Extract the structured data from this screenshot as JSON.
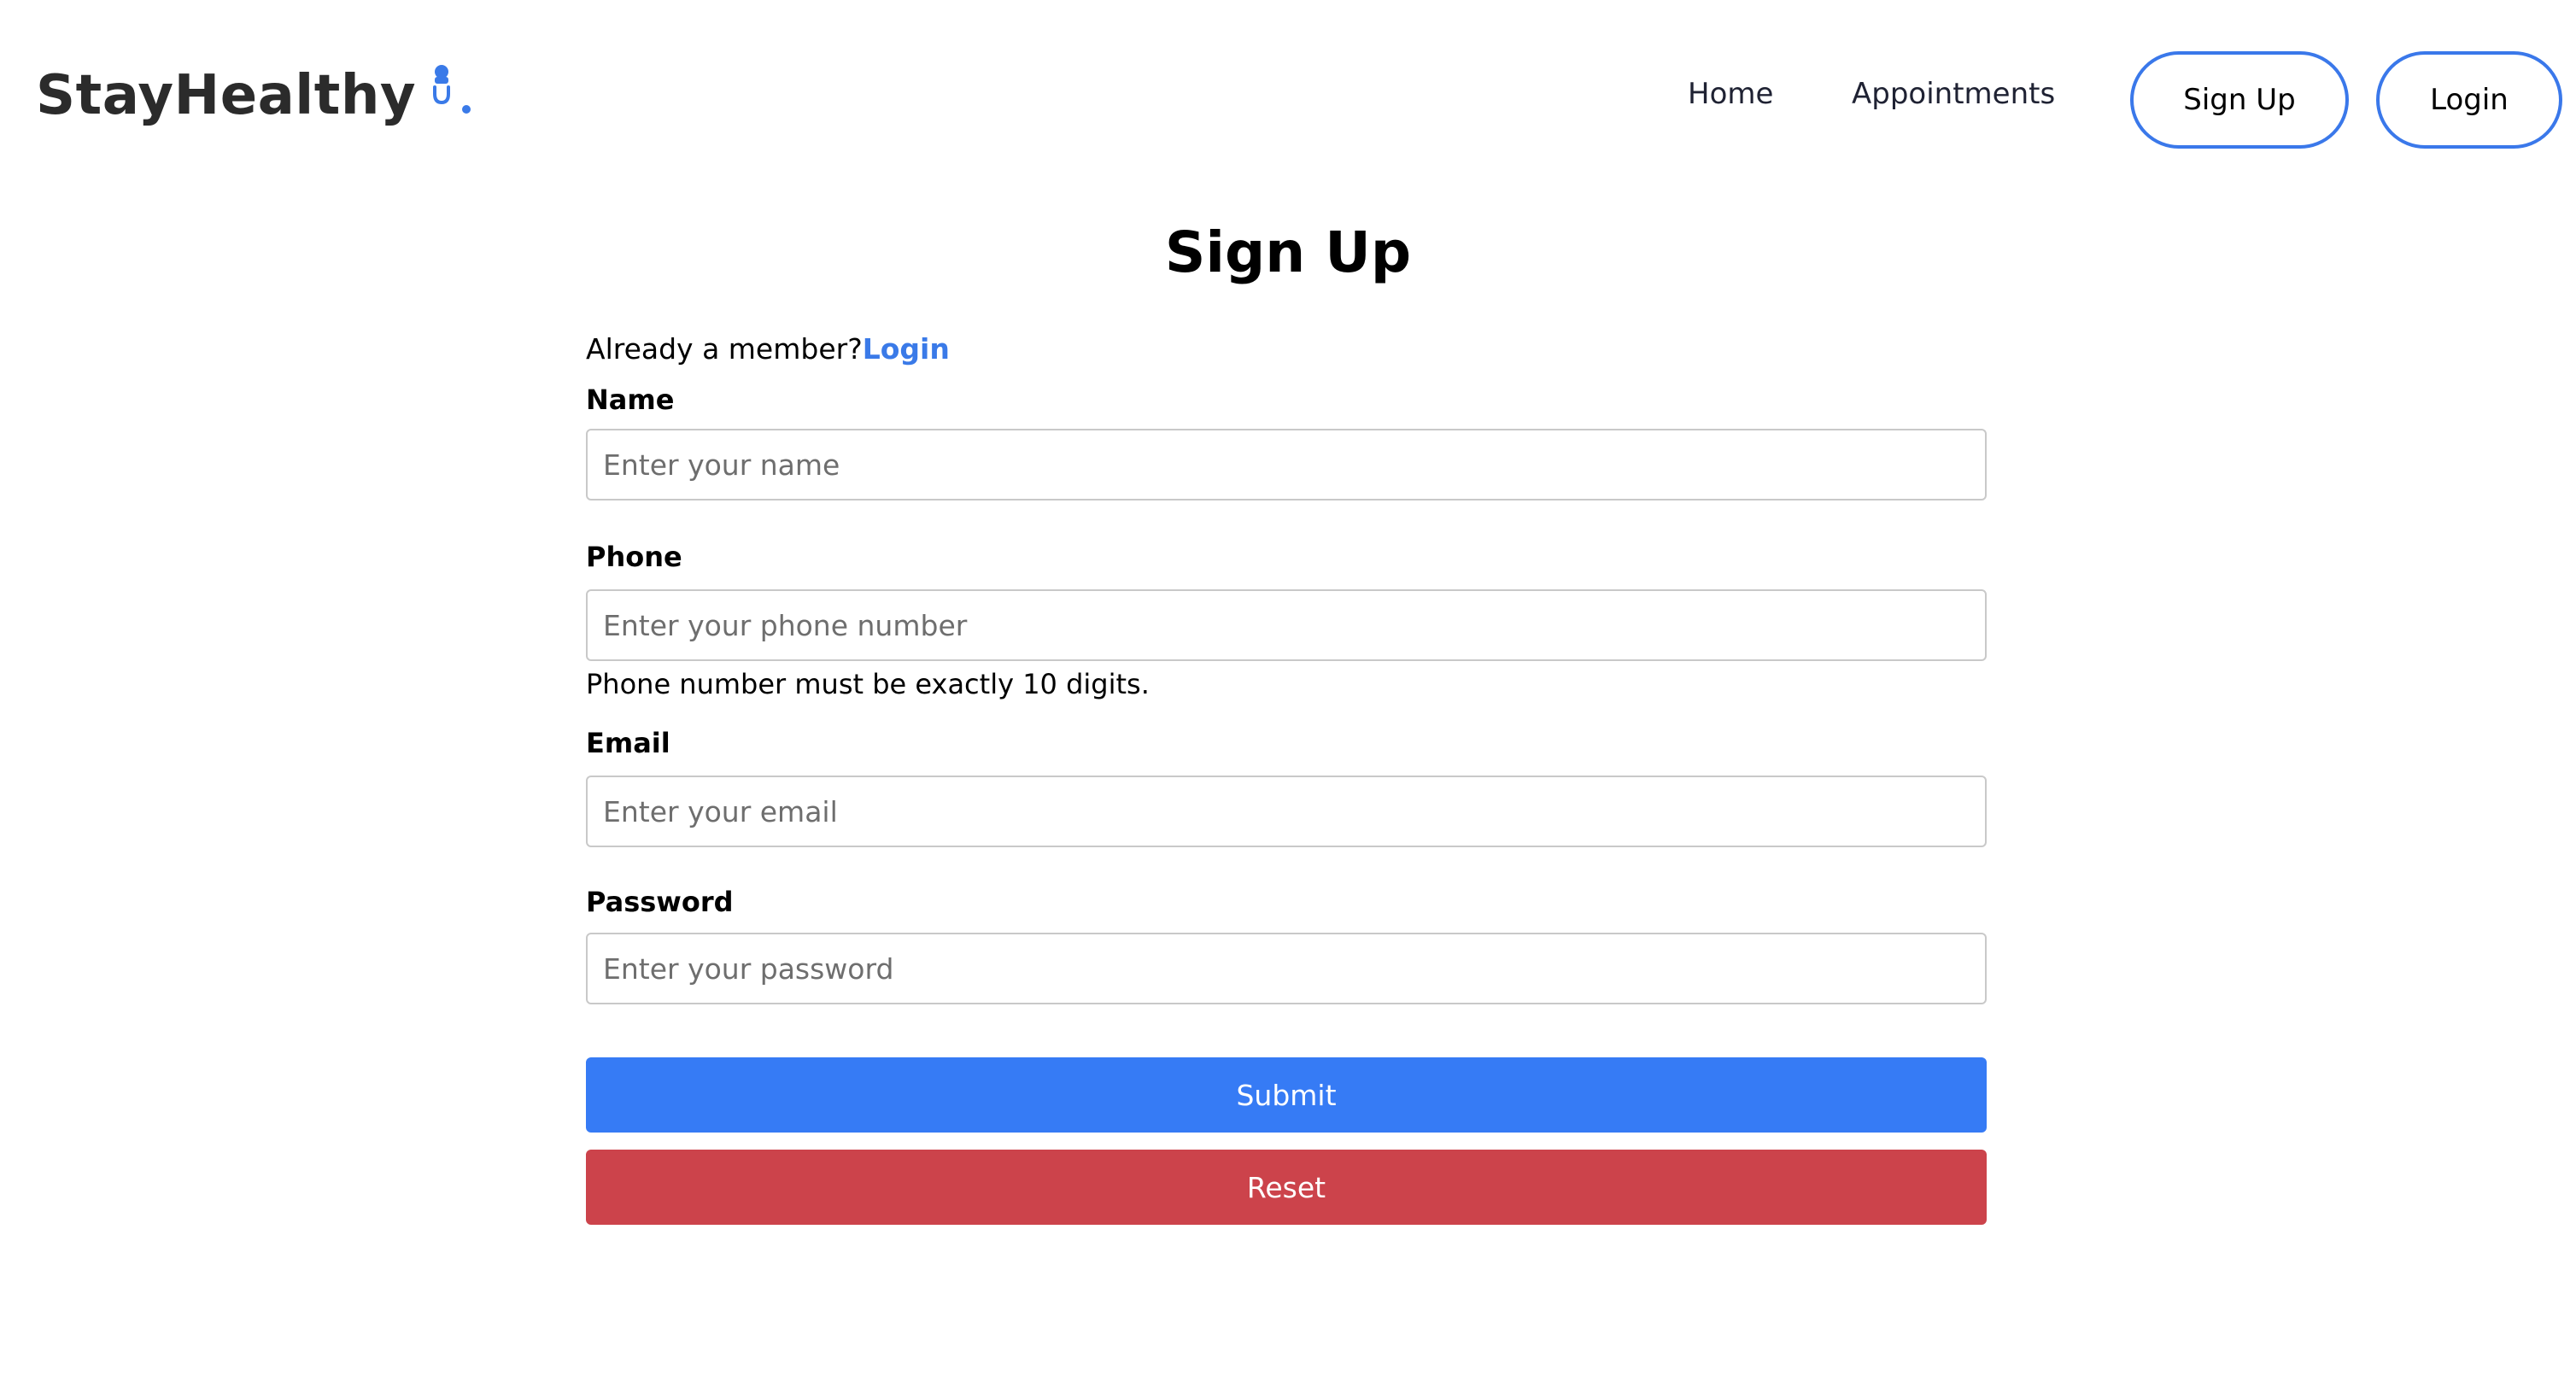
{
  "brand": {
    "name": "StayHealthy",
    "accent": "#3a7ae8",
    "icon": "stethoscope-icon"
  },
  "nav": {
    "links": [
      {
        "label": "Home"
      },
      {
        "label": "Appointments"
      }
    ],
    "signup_label": "Sign Up",
    "login_label": "Login"
  },
  "page": {
    "title": "Sign Up"
  },
  "form": {
    "member_prompt": "Already a member?",
    "member_link": "Login",
    "fields": [
      {
        "label": "Name",
        "placeholder": "Enter your name",
        "value": ""
      },
      {
        "label": "Phone",
        "placeholder": "Enter your phone number",
        "value": "",
        "hint": "Phone number must be exactly 10 digits."
      },
      {
        "label": "Email",
        "placeholder": "Enter your email",
        "value": ""
      },
      {
        "label": "Password",
        "placeholder": "Enter your password",
        "value": ""
      }
    ],
    "submit_label": "Submit",
    "reset_label": "Reset"
  },
  "colors": {
    "submit": "#367bf5",
    "reset": "#cc434b",
    "outline": "#3a78ea"
  }
}
